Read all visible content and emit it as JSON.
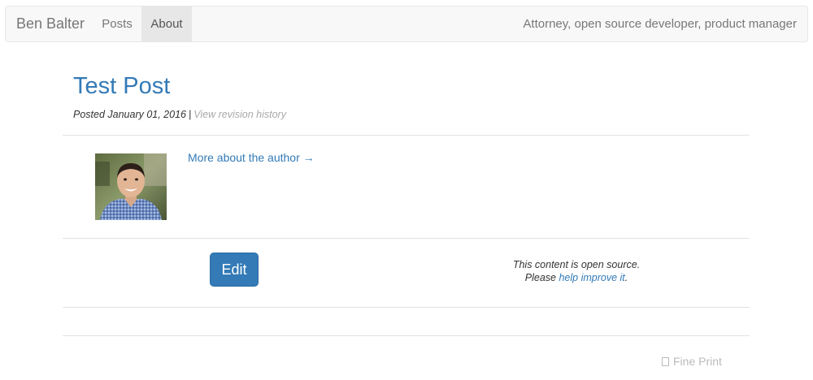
{
  "navbar": {
    "brand": "Ben Balter",
    "items": [
      {
        "label": "Posts",
        "active": false
      },
      {
        "label": "About",
        "active": true
      }
    ],
    "tagline": "Attorney, open source developer, product manager"
  },
  "post": {
    "title": "Test Post",
    "posted_label": "Posted January 01, 2016",
    "separator": "|",
    "revision_link": "View revision history"
  },
  "author": {
    "link": "More about the author →"
  },
  "actions": {
    "edit_label": "Edit",
    "open_source_line1": "This content is open source.",
    "open_source_please": "Please",
    "help_link": "help improve it",
    "period": "."
  },
  "footer": {
    "fine_print": "Fine Print"
  },
  "colors": {
    "link": "#337ab7",
    "navbar_bg": "#f8f8f8",
    "muted": "#777777",
    "button": "#337ab7"
  }
}
